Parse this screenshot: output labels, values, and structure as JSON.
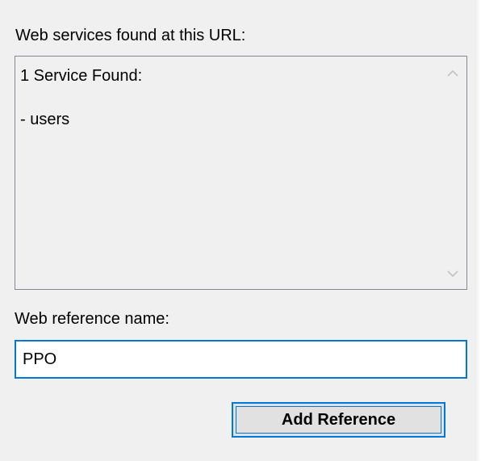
{
  "services": {
    "label": "Web services found at this URL:",
    "found_text": "1 Service Found:",
    "items": [
      "- users"
    ]
  },
  "reference": {
    "label": "Web reference name:",
    "value": "PPO"
  },
  "buttons": {
    "add_reference": "Add Reference"
  },
  "colors": {
    "panel_bg": "#f0f0f0",
    "focus_border": "#0078d7",
    "box_border": "#828790",
    "button_bg": "#e1e1e1"
  },
  "icons": {
    "scroll_up": "chevron-up-icon",
    "scroll_down": "chevron-down-icon"
  }
}
